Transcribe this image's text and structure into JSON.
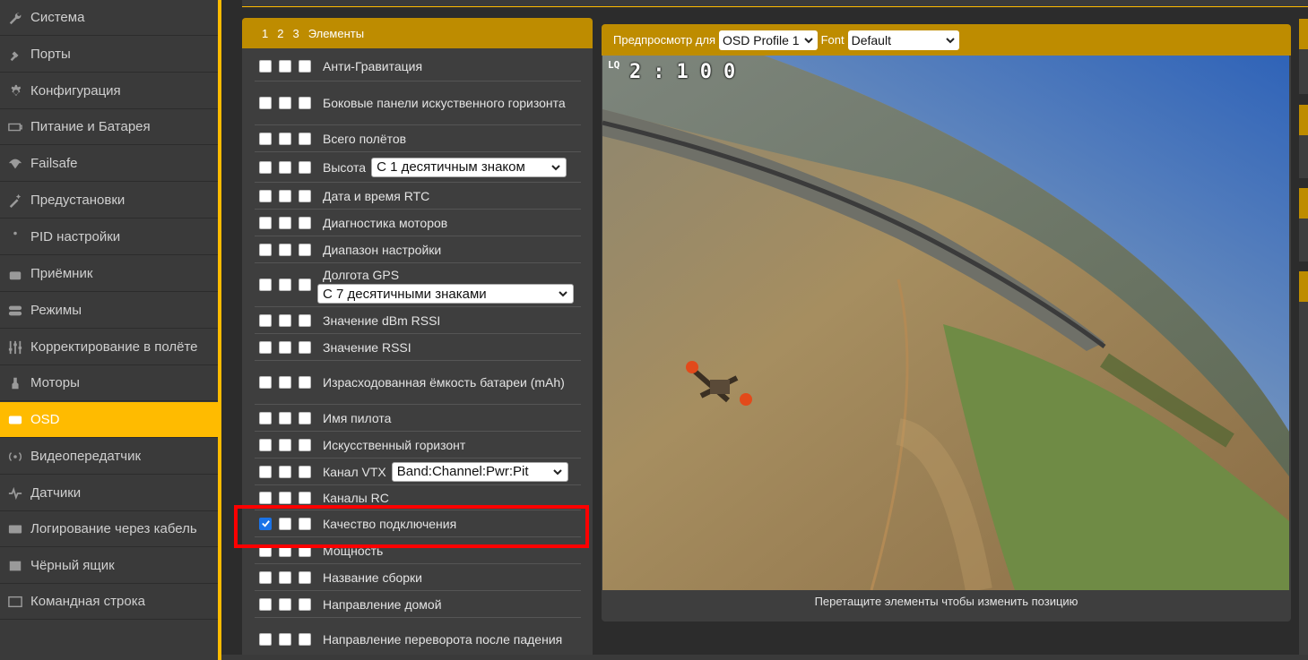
{
  "sidebar": {
    "items": [
      {
        "label": "Система",
        "icon": "wrench-icon"
      },
      {
        "label": "Порты",
        "icon": "plug-icon"
      },
      {
        "label": "Конфигурация",
        "icon": "gear-icon"
      },
      {
        "label": "Питание и Батарея",
        "icon": "battery-icon"
      },
      {
        "label": "Failsafe",
        "icon": "parachute-icon"
      },
      {
        "label": "Предустановки",
        "icon": "wand-icon"
      },
      {
        "label": "PID настройки",
        "icon": "pid-icon"
      },
      {
        "label": "Приёмник",
        "icon": "receiver-icon"
      },
      {
        "label": "Режимы",
        "icon": "toggle-icon"
      },
      {
        "label": "Корректирование в полёте",
        "icon": "sliders-icon"
      },
      {
        "label": "Моторы",
        "icon": "motor-icon"
      },
      {
        "label": "OSD",
        "icon": "osd-icon",
        "active": true
      },
      {
        "label": "Видеопередатчик",
        "icon": "antenna-icon"
      },
      {
        "label": "Датчики",
        "icon": "pulse-icon"
      },
      {
        "label": "Логирование через кабель",
        "icon": "logging-icon"
      },
      {
        "label": "Чёрный ящик",
        "icon": "blackbox-icon"
      },
      {
        "label": "Командная строка",
        "icon": "terminal-icon"
      }
    ]
  },
  "elements": {
    "header": {
      "p1": "1",
      "p2": "2",
      "p3": "3",
      "title": "Элементы"
    },
    "rows": [
      {
        "label": "Анти-Гравитация"
      },
      {
        "label": "Боковые панели искуственного горизонта"
      },
      {
        "label": "Всего полётов"
      },
      {
        "label": "Высота",
        "select": "С 1 десятичным знаком"
      },
      {
        "label": "Дата и время RTC"
      },
      {
        "label": "Диагностика моторов"
      },
      {
        "label": "Диапазон настройки"
      },
      {
        "label": "Долгота GPS",
        "select": "С 7 десятичными знаками"
      },
      {
        "label": "Значение dBm RSSI"
      },
      {
        "label": "Значение RSSI"
      },
      {
        "label": "Израсходованная ёмкость батареи (mAh)"
      },
      {
        "label": "Имя пилота"
      },
      {
        "label": "Искусственный горизонт"
      },
      {
        "label": "Канал VTX",
        "select": "Band:Channel:Pwr:Pit"
      },
      {
        "label": "Каналы RC"
      },
      {
        "label": "Качество подключения",
        "checked1": true
      },
      {
        "label": "Мощность"
      },
      {
        "label": "Название сборки"
      },
      {
        "label": "Направление домой"
      },
      {
        "label": "Направление переворота после падения"
      }
    ]
  },
  "preview": {
    "label": "Предпросмотр для",
    "profile": "OSD Profile 1",
    "font_label": "Font",
    "font": "Default",
    "footer": "Перетащите элементы чтобы изменить позицию",
    "osd_lq": "LQ",
    "osd_value": "2:100"
  },
  "colors": {
    "accent": "#ffbb00",
    "header": "#be8c00",
    "highlight": "#ff0000"
  }
}
